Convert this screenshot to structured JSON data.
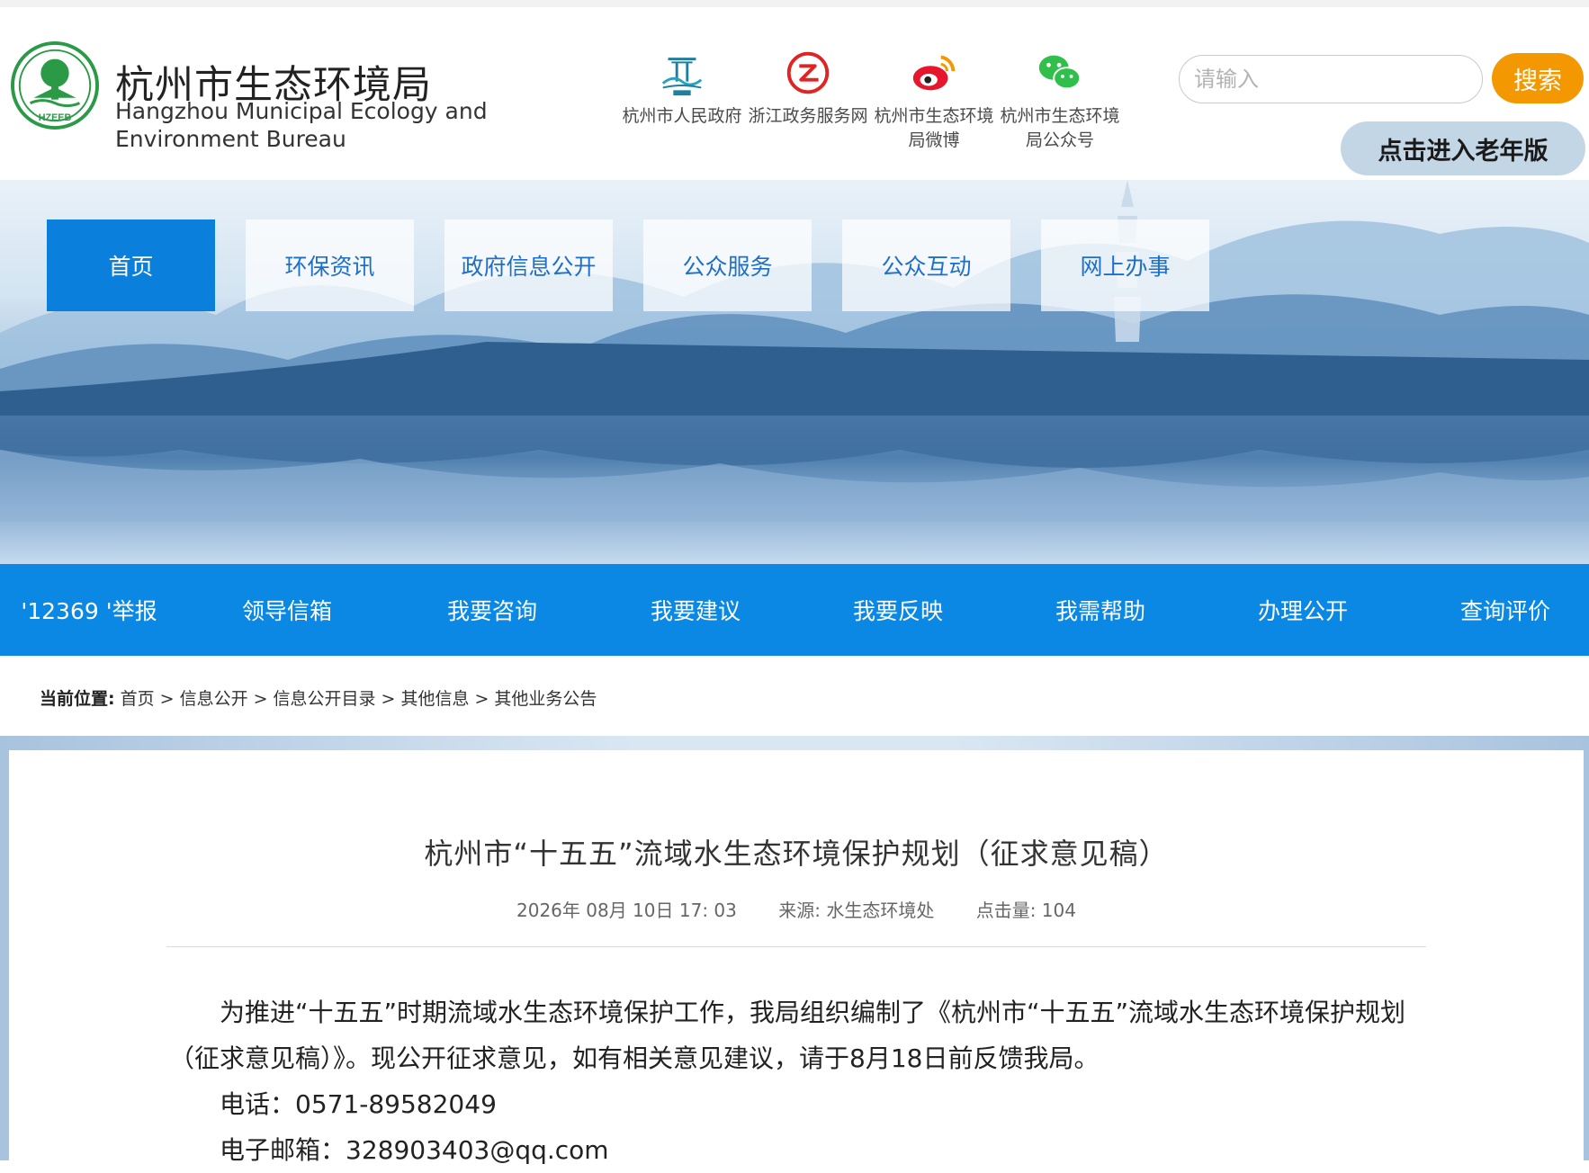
{
  "header": {
    "site_name_cn": "杭州市生态环境局",
    "site_name_en": "Hangzhou Municipal Ecology and Environment Bureau",
    "logo_text": "HZEEB",
    "quick_links": [
      {
        "label": "杭州市人民政府",
        "icon": "hangzhou-gov-icon"
      },
      {
        "label": "浙江政务服务网",
        "icon": "zhejiang-service-icon"
      },
      {
        "label": "杭州市生态环境局微博",
        "icon": "weibo-icon"
      },
      {
        "label": "杭州市生态环境局公众号",
        "icon": "wechat-icon"
      }
    ],
    "search": {
      "placeholder": "请输入",
      "button_label": "搜索"
    },
    "elder_version_label": "点击进入老年版"
  },
  "nav": {
    "items": [
      {
        "label": "首页",
        "active": true
      },
      {
        "label": "环保资讯"
      },
      {
        "label": "政府信息公开"
      },
      {
        "label": "公众服务"
      },
      {
        "label": "公众互动"
      },
      {
        "label": "网上办事"
      }
    ]
  },
  "service_bar": {
    "items": [
      "'12369 '举报",
      "领导信箱",
      "我要咨询",
      "我要建议",
      "我要反映",
      "我需帮助",
      "办理公开",
      "查询评价"
    ]
  },
  "breadcrumb": {
    "label": "当前位置:",
    "items": [
      "首页",
      "信息公开",
      "信息公开目录",
      "其他信息",
      "其他业务公告"
    ]
  },
  "article": {
    "title": "杭州市“十五五”流域水生态环境保护规划（征求意见稿）",
    "date": "2026年 08月 10日 17: 03",
    "source": "来源: 水生态环境处",
    "clicks": "点击量: 104",
    "paragraph1": "为推进“十五五”时期流域水生态环境保护工作，我局组织编制了《杭州市“十五五”流域水生态环境保护规划（征求意见稿）》。现公开征求意见，如有相关意见建议，请于8月18日前反馈我局。",
    "phone": "电话：0571-89582049",
    "email": "电子邮箱：328903403@qq.com"
  },
  "colors": {
    "nav_active": "#0a7fdb",
    "service_bar": "#0a88e3",
    "search_button": "#f39800",
    "elder_button": "#c3d6e6",
    "logo_green": "#2a9a46"
  }
}
